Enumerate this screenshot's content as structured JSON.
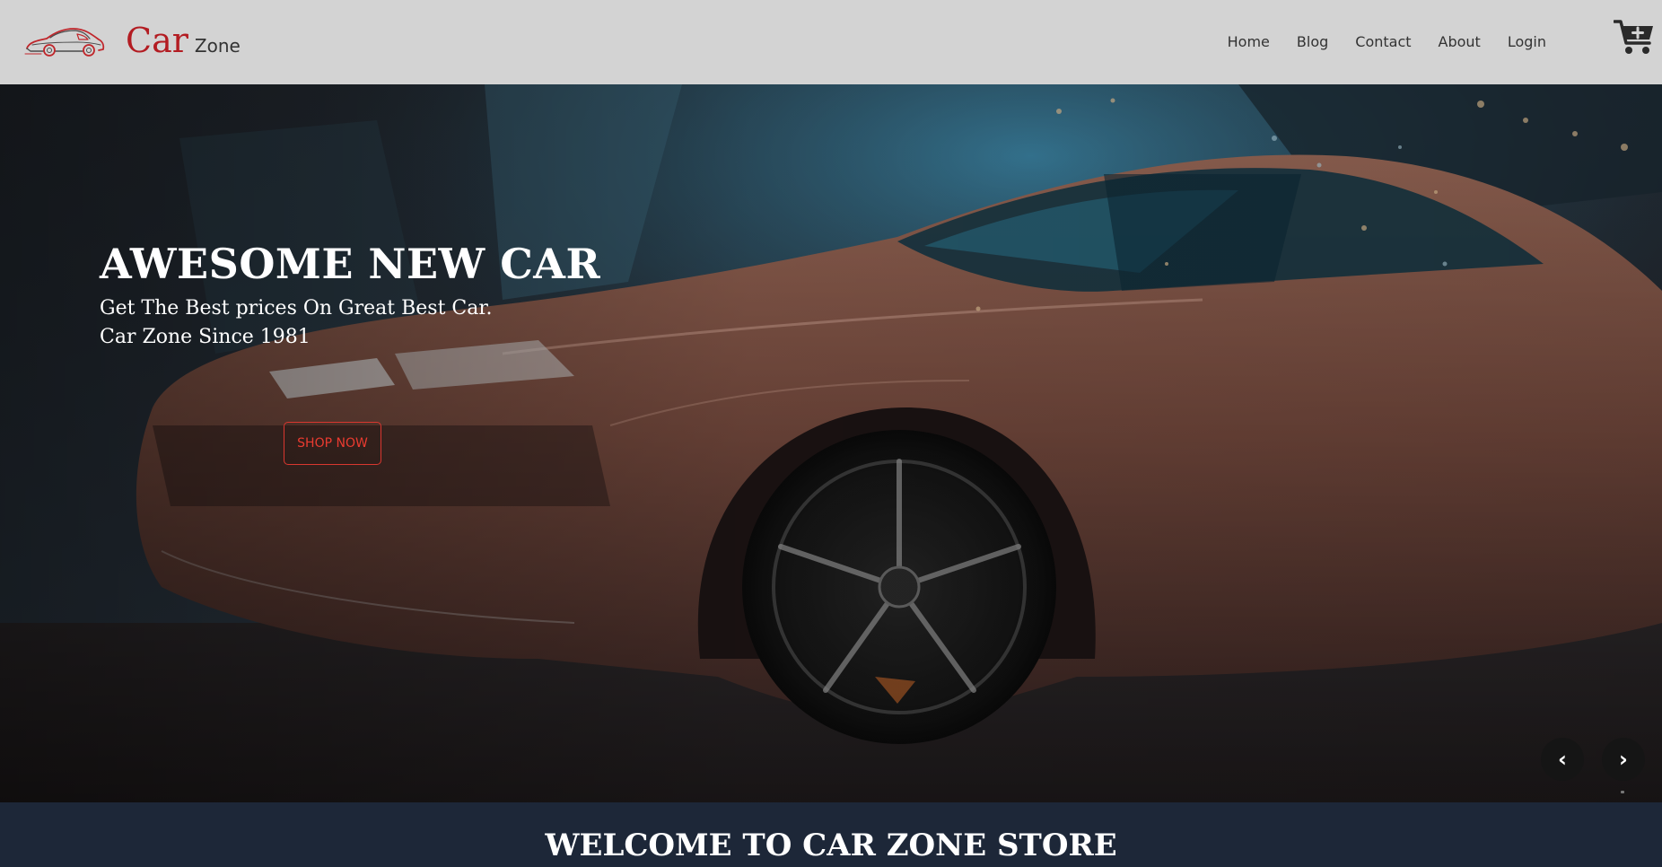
{
  "brand": {
    "name_primary": "Car",
    "name_secondary": "Zone",
    "logo_icon": "car-outline-logo-icon",
    "accent_color": "#b31c22"
  },
  "nav": {
    "items": [
      {
        "label": "Home"
      },
      {
        "label": "Blog"
      },
      {
        "label": "Contact"
      },
      {
        "label": "About"
      },
      {
        "label": "Login"
      }
    ],
    "cart_icon": "cart-plus-icon"
  },
  "hero": {
    "title": "AWESOME NEW CAR",
    "subtitle_line1": "Get The Best prices On Great Best Car.",
    "subtitle_line2": "Car Zone Since 1981",
    "cta_label": "SHOP NOW",
    "cta_color": "#ea3b30",
    "prev_icon": "‹",
    "next_icon": "›"
  },
  "welcome": {
    "title": "WELCOME TO CAR ZONE STORE",
    "background": "#1d2738"
  }
}
